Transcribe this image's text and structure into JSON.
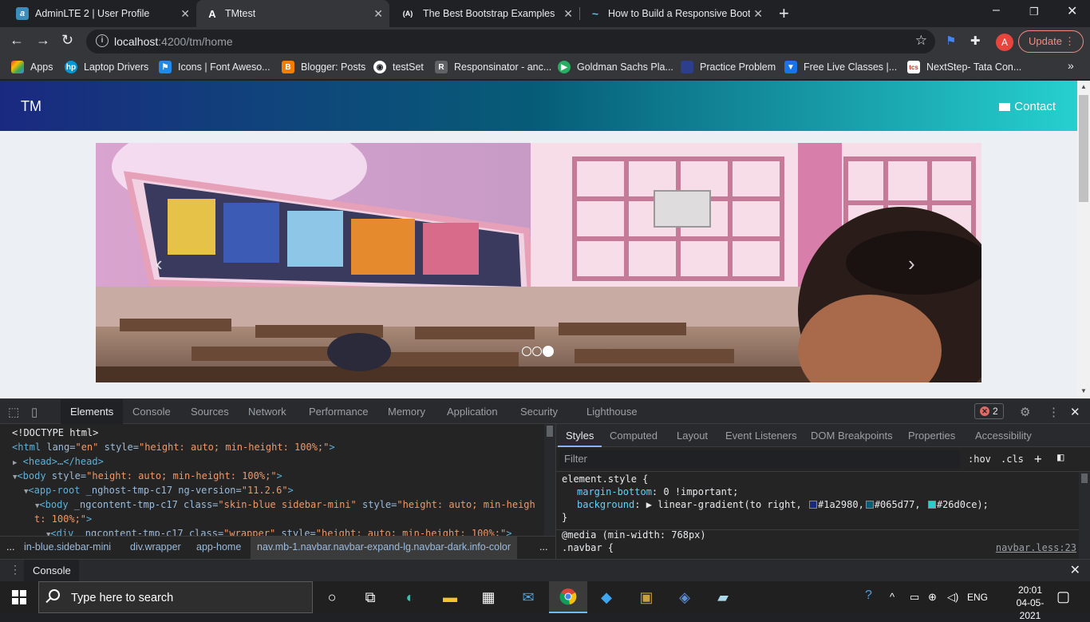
{
  "browser": {
    "tabs": [
      {
        "title": "AdminLTE 2 | User Profile",
        "icon": "adminlte-icon",
        "color": "#3c8dbc",
        "glyph": "a"
      },
      {
        "title": "TMtest",
        "icon": "angular-icon",
        "color": "#202124",
        "glyph": "A",
        "active": true
      },
      {
        "title": "The Best Bootstrap Examples",
        "icon": "bootstrap-a-icon",
        "color": "#202124",
        "glyph": "(A)"
      },
      {
        "title": "How to Build a Responsive Boots",
        "icon": "wave-icon",
        "color": "#202124",
        "glyph": "~"
      }
    ],
    "url_host": "localhost",
    "url_path": ":4200/tm/home",
    "avatar_letter": "A",
    "update_label": "Update",
    "bookmarks": [
      {
        "label": "Apps",
        "icon": "apps-grid-icon",
        "color": "#ea4335"
      },
      {
        "label": "Laptop Drivers",
        "icon": "hp-icon",
        "color": "#0096d6"
      },
      {
        "label": "Icons | Font Aweso...",
        "icon": "flag-icon",
        "color": "#228ae6"
      },
      {
        "label": "Blogger: Posts",
        "icon": "blogger-icon",
        "color": "#f57d00"
      },
      {
        "label": "testSet",
        "icon": "globe-icon",
        "color": "#5f6368"
      },
      {
        "label": "Responsinator - anc...",
        "icon": "r-icon",
        "color": "#5f6368"
      },
      {
        "label": "Goldman Sachs Pla...",
        "icon": "gs-icon",
        "color": "#27ae60"
      },
      {
        "label": "Practice Problem",
        "icon": "practice-icon",
        "color": "#2c3e8c"
      },
      {
        "label": "Free Live Classes |...",
        "icon": "live-icon",
        "color": "#1a73e8"
      },
      {
        "label": "NextStep- Tata Con...",
        "icon": "tcs-icon",
        "color": "#c0392b"
      }
    ]
  },
  "page": {
    "brand": "TM",
    "contact_label": "Contact",
    "navbar_gradient": [
      "#1a2980",
      "#065d77",
      "#26d0ce"
    ],
    "carousel": {
      "slide_count": 3,
      "active_index": 2,
      "prev": "‹",
      "next": "›"
    }
  },
  "devtools": {
    "tabs": [
      "Elements",
      "Console",
      "Sources",
      "Network",
      "Performance",
      "Memory",
      "Application",
      "Security",
      "Lighthouse"
    ],
    "active_tab": "Elements",
    "error_count": "2",
    "code": {
      "l1": "<!DOCTYPE html>",
      "l2_tag": "<html",
      "l2_a1": " lang=",
      "l2_v1": "\"en\"",
      "l2_a2": " style=",
      "l2_v2": "\"height: auto; min-height: 100%;\"",
      "l2_end": ">",
      "l3": "<head>…</head>",
      "l4_tag": "<body",
      "l4_a": " style=",
      "l4_v": "\"height: auto; min-height: 100%;\"",
      "l4_end": ">",
      "l5_tag": "<app-root",
      "l5_a": " _nghost-tmp-c17 ng-version=",
      "l5_v": "\"11.2.6\"",
      "l5_end": ">",
      "l6_tag": "<body",
      "l6_a1": " _ngcontent-tmp-c17 class=",
      "l6_v1": "\"skin-blue sidebar-mini\"",
      "l6_a2": " style=",
      "l6_v2": "\"height: auto; min-heigh",
      "l7_v": "t: 100%;\"",
      "l7_end": ">",
      "l8_tag": "<div",
      "l8_a1": " _ngcontent-tmp-c17 class=",
      "l8_v1": "\"wrapper\"",
      "l8_a2": " style=",
      "l8_v2": "\"height: auto; min-height: 100%;\"",
      "l8_end": ">"
    },
    "breadcrumbs": [
      "...",
      "in-blue.sidebar-mini",
      "div.wrapper",
      "app-home",
      "nav.mb-1.navbar.navbar-expand-lg.navbar-dark.info-color",
      "..."
    ],
    "styles_tabs": [
      "Styles",
      "Computed",
      "Layout",
      "Event Listeners",
      "DOM Breakpoints",
      "Properties",
      "Accessibility"
    ],
    "filter_placeholder": "Filter",
    "hov": ":hov",
    "cls": ".cls",
    "rules": {
      "selector1": "element.style {",
      "p1_name": "margin-bottom",
      "p1_val": ": 0 !important;",
      "p2_name": "background",
      "p2_val_pre": ": ▶ linear-gradient(to right, ",
      "c1": "#1a2980",
      "c2": "#065d77",
      "c3": "#26d0ce",
      "close1": "}",
      "media": "@media (min-width: 768px)",
      "selector2": ".navbar {",
      "source": "navbar.less:23"
    },
    "drawer_tab": "Console"
  },
  "taskbar": {
    "search_placeholder": "Type here to search",
    "lang": "ENG",
    "time": "20:01",
    "date": "04-05-2021"
  }
}
